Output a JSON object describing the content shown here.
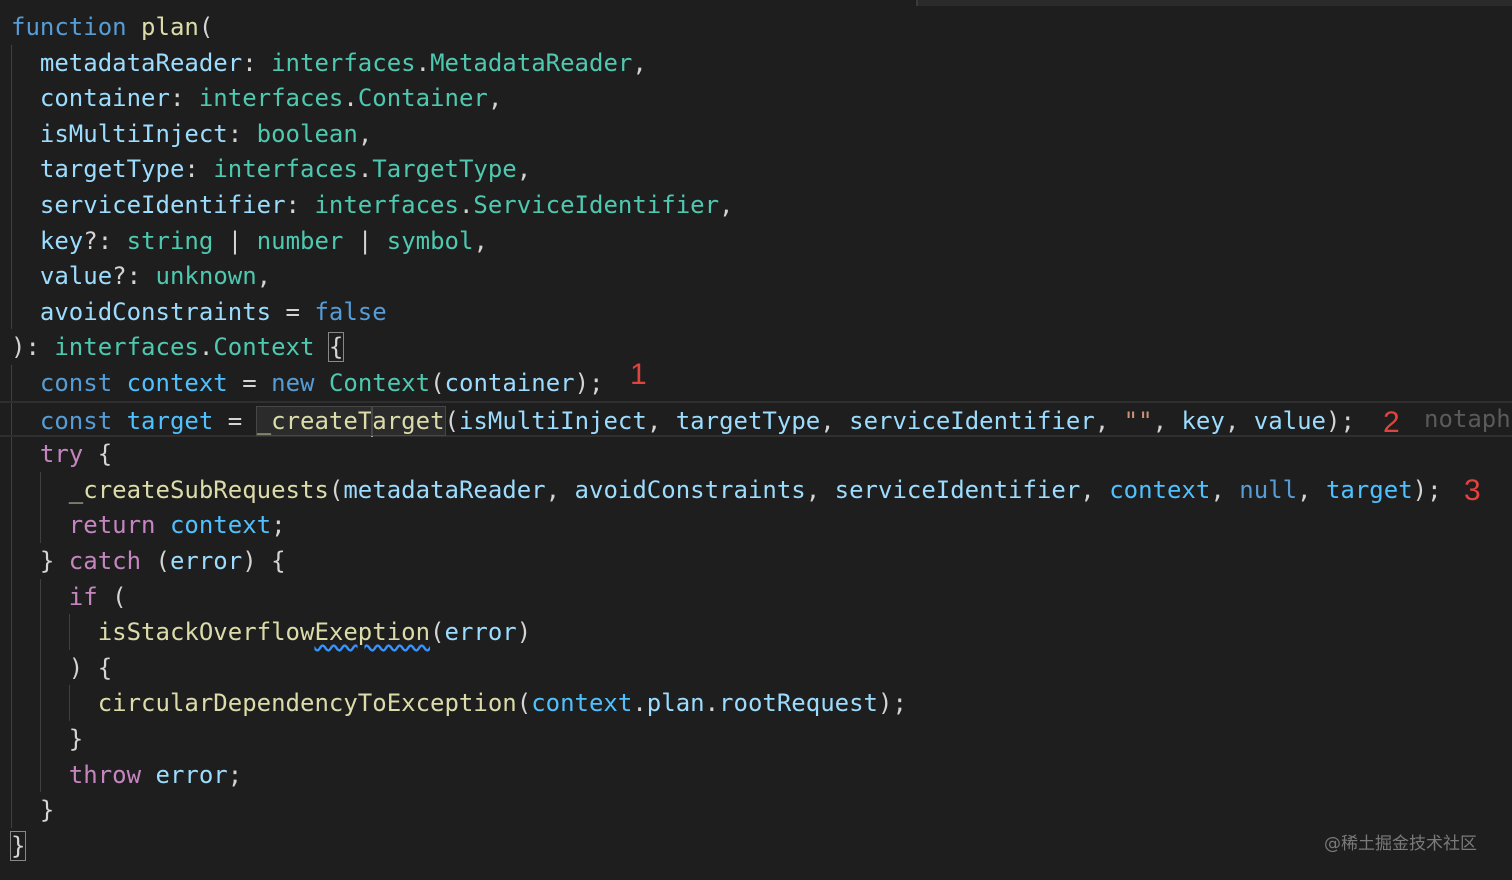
{
  "editor": {
    "lines": [
      {
        "tokens": [
          {
            "t": "function",
            "c": "kw"
          },
          {
            "t": " "
          },
          {
            "t": "plan",
            "c": "fn"
          },
          {
            "t": "("
          }
        ]
      },
      {
        "tokens": [
          {
            "t": "  "
          },
          {
            "t": "metadataReader",
            "c": "var"
          },
          {
            "t": ": "
          },
          {
            "t": "interfaces",
            "c": "type"
          },
          {
            "t": "."
          },
          {
            "t": "MetadataReader",
            "c": "type"
          },
          {
            "t": ","
          }
        ]
      },
      {
        "tokens": [
          {
            "t": "  "
          },
          {
            "t": "container",
            "c": "var"
          },
          {
            "t": ": "
          },
          {
            "t": "interfaces",
            "c": "type"
          },
          {
            "t": "."
          },
          {
            "t": "Container",
            "c": "type"
          },
          {
            "t": ","
          }
        ]
      },
      {
        "tokens": [
          {
            "t": "  "
          },
          {
            "t": "isMultiInject",
            "c": "var"
          },
          {
            "t": ": "
          },
          {
            "t": "boolean",
            "c": "type"
          },
          {
            "t": ","
          }
        ]
      },
      {
        "tokens": [
          {
            "t": "  "
          },
          {
            "t": "targetType",
            "c": "var"
          },
          {
            "t": ": "
          },
          {
            "t": "interfaces",
            "c": "type"
          },
          {
            "t": "."
          },
          {
            "t": "TargetType",
            "c": "type"
          },
          {
            "t": ","
          }
        ]
      },
      {
        "tokens": [
          {
            "t": "  "
          },
          {
            "t": "serviceIdentifier",
            "c": "var"
          },
          {
            "t": ": "
          },
          {
            "t": "interfaces",
            "c": "type"
          },
          {
            "t": "."
          },
          {
            "t": "ServiceIdentifier",
            "c": "type"
          },
          {
            "t": ","
          }
        ]
      },
      {
        "tokens": [
          {
            "t": "  "
          },
          {
            "t": "key",
            "c": "var"
          },
          {
            "t": "?: "
          },
          {
            "t": "string",
            "c": "type"
          },
          {
            "t": " | "
          },
          {
            "t": "number",
            "c": "type"
          },
          {
            "t": " | "
          },
          {
            "t": "symbol",
            "c": "type"
          },
          {
            "t": ","
          }
        ]
      },
      {
        "tokens": [
          {
            "t": "  "
          },
          {
            "t": "value",
            "c": "var"
          },
          {
            "t": "?: "
          },
          {
            "t": "unknown",
            "c": "type"
          },
          {
            "t": ","
          }
        ]
      },
      {
        "tokens": [
          {
            "t": "  "
          },
          {
            "t": "avoidConstraints",
            "c": "var"
          },
          {
            "t": " = "
          },
          {
            "t": "false",
            "c": "kw"
          }
        ]
      },
      {
        "tokens": [
          {
            "t": "): "
          },
          {
            "t": "interfaces",
            "c": "type"
          },
          {
            "t": "."
          },
          {
            "t": "Context",
            "c": "type"
          },
          {
            "t": " "
          },
          {
            "t": "{",
            "c": "bm"
          }
        ]
      },
      {
        "tokens": [
          {
            "t": "  "
          },
          {
            "t": "const",
            "c": "kw"
          },
          {
            "t": " "
          },
          {
            "t": "context",
            "c": "const"
          },
          {
            "t": " = "
          },
          {
            "t": "new",
            "c": "kw"
          },
          {
            "t": " "
          },
          {
            "t": "Context",
            "c": "type"
          },
          {
            "t": "("
          },
          {
            "t": "container",
            "c": "var"
          },
          {
            "t": ");"
          }
        ]
      },
      {
        "current": true,
        "tokens": [
          {
            "t": "  "
          },
          {
            "t": "const",
            "c": "kw"
          },
          {
            "t": " "
          },
          {
            "t": "target",
            "c": "const"
          },
          {
            "t": " = "
          },
          {
            "t": "_createT",
            "c": "fn hl"
          },
          {
            "t": "",
            "c": "cursor"
          },
          {
            "t": "arget",
            "c": "fn hl"
          },
          {
            "t": "("
          },
          {
            "t": "isMultiInject",
            "c": "var"
          },
          {
            "t": ", "
          },
          {
            "t": "targetType",
            "c": "var"
          },
          {
            "t": ", "
          },
          {
            "t": "serviceIdentifier",
            "c": "var"
          },
          {
            "t": ", "
          },
          {
            "t": "\"\"",
            "c": "str"
          },
          {
            "t": ", "
          },
          {
            "t": "key",
            "c": "var"
          },
          {
            "t": ", "
          },
          {
            "t": "value",
            "c": "var"
          },
          {
            "t": ");"
          }
        ]
      },
      {
        "tokens": [
          {
            "t": "  "
          },
          {
            "t": "try",
            "c": "ctl"
          },
          {
            "t": " {"
          }
        ]
      },
      {
        "tokens": [
          {
            "t": "    "
          },
          {
            "t": "_createSubRequests",
            "c": "fn"
          },
          {
            "t": "("
          },
          {
            "t": "metadataReader",
            "c": "var"
          },
          {
            "t": ", "
          },
          {
            "t": "avoidConstraints",
            "c": "var"
          },
          {
            "t": ", "
          },
          {
            "t": "serviceIdentifier",
            "c": "var"
          },
          {
            "t": ", "
          },
          {
            "t": "context",
            "c": "const"
          },
          {
            "t": ", "
          },
          {
            "t": "null",
            "c": "kw"
          },
          {
            "t": ", "
          },
          {
            "t": "target",
            "c": "const"
          },
          {
            "t": ");"
          }
        ]
      },
      {
        "tokens": [
          {
            "t": "    "
          },
          {
            "t": "return",
            "c": "ctl"
          },
          {
            "t": " "
          },
          {
            "t": "context",
            "c": "const"
          },
          {
            "t": ";"
          }
        ]
      },
      {
        "tokens": [
          {
            "t": "  } "
          },
          {
            "t": "catch",
            "c": "ctl"
          },
          {
            "t": " ("
          },
          {
            "t": "error",
            "c": "var"
          },
          {
            "t": ") {"
          }
        ]
      },
      {
        "tokens": [
          {
            "t": "    "
          },
          {
            "t": "if",
            "c": "ctl"
          },
          {
            "t": " ("
          }
        ]
      },
      {
        "tokens": [
          {
            "t": "      "
          },
          {
            "t": "isStackOverflow",
            "c": "fn"
          },
          {
            "t": "Exeption",
            "c": "fn sq"
          },
          {
            "t": "("
          },
          {
            "t": "error",
            "c": "var"
          },
          {
            "t": ")"
          }
        ]
      },
      {
        "tokens": [
          {
            "t": "    ) {"
          }
        ]
      },
      {
        "tokens": [
          {
            "t": "      "
          },
          {
            "t": "circularDependencyToException",
            "c": "fn"
          },
          {
            "t": "("
          },
          {
            "t": "context",
            "c": "const"
          },
          {
            "t": "."
          },
          {
            "t": "plan",
            "c": "var"
          },
          {
            "t": "."
          },
          {
            "t": "rootRequest",
            "c": "var"
          },
          {
            "t": ");"
          }
        ]
      },
      {
        "tokens": [
          {
            "t": "    }"
          }
        ]
      },
      {
        "tokens": [
          {
            "t": "    "
          },
          {
            "t": "throw",
            "c": "ctl"
          },
          {
            "t": " "
          },
          {
            "t": "error",
            "c": "var"
          },
          {
            "t": ";"
          }
        ]
      },
      {
        "tokens": [
          {
            "t": "  }"
          }
        ]
      },
      {
        "tokens": [
          {
            "t": "}",
            "c": "bm"
          }
        ]
      }
    ],
    "ghost_text": "notaph"
  },
  "annotations": [
    {
      "label": "1",
      "line": 10
    },
    {
      "label": "2",
      "line": 11
    },
    {
      "label": "3",
      "line": 13
    }
  ],
  "watermark": "@稀土掘金技术社区",
  "colors": {
    "background": "#1e1e1e",
    "keyword": "#569cd6",
    "control": "#c586c0",
    "function": "#dcdcaa",
    "variable": "#9cdcfe",
    "type": "#4ec9b0",
    "constant": "#4fc1ff",
    "string": "#ce9178",
    "annotation": "#e0443e"
  }
}
